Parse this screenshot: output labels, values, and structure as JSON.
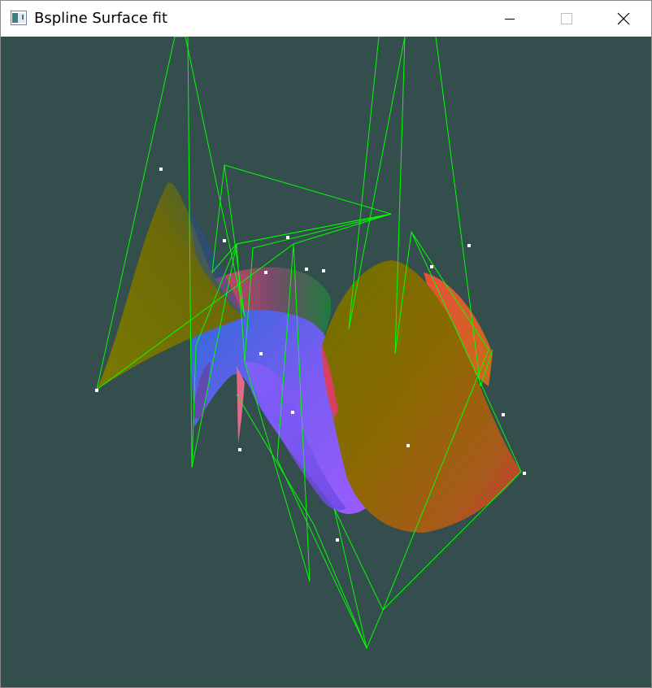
{
  "window": {
    "title": "Bspline Surface fit",
    "icon": "opengl-app-icon",
    "controls": [
      "minimize-icon",
      "maximize-icon",
      "close-icon"
    ]
  },
  "viewport": {
    "background": "#344d4d",
    "control_net_color": "#00ff00",
    "point_color": "#ffffff"
  }
}
